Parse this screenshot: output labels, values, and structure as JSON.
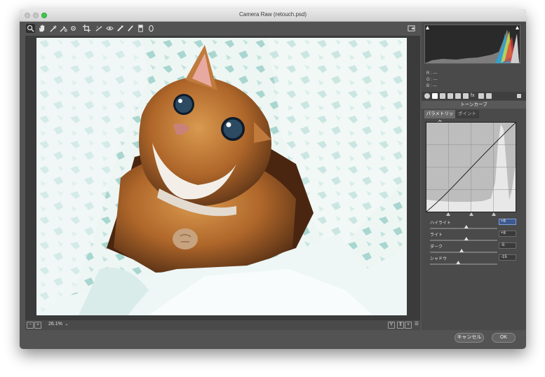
{
  "window": {
    "title": "Camera Raw (retouch.psd)"
  },
  "toolbar": {
    "tools": [
      "zoom-icon",
      "hand-icon",
      "white-balance-icon",
      "color-sampler-icon",
      "target-adjust-icon",
      "crop-icon",
      "straighten-icon",
      "red-eye-icon",
      "spot-removal-icon",
      "adjustment-brush-icon",
      "graduated-filter-icon",
      "radial-filter-icon"
    ]
  },
  "statusbar": {
    "zoom": "26.1%",
    "y_label": "Y"
  },
  "histogram": {
    "r": "R :   ---",
    "g": "G :   ---",
    "b": "B :   ---"
  },
  "panel": {
    "title": "トーンカーブ",
    "tabs": [
      "パラメトリック",
      "ポイント"
    ],
    "sliders": [
      {
        "label": "ハイライト",
        "value": "+8",
        "level": 0.54
      },
      {
        "label": "ライト",
        "value": "+8",
        "level": 0.54
      },
      {
        "label": "ダーク",
        "value": "-5",
        "level": 0.47
      },
      {
        "label": "シャドウ",
        "value": "-15",
        "level": 0.42
      }
    ]
  },
  "buttons": {
    "cancel": "キャンセル",
    "ok": "OK"
  }
}
